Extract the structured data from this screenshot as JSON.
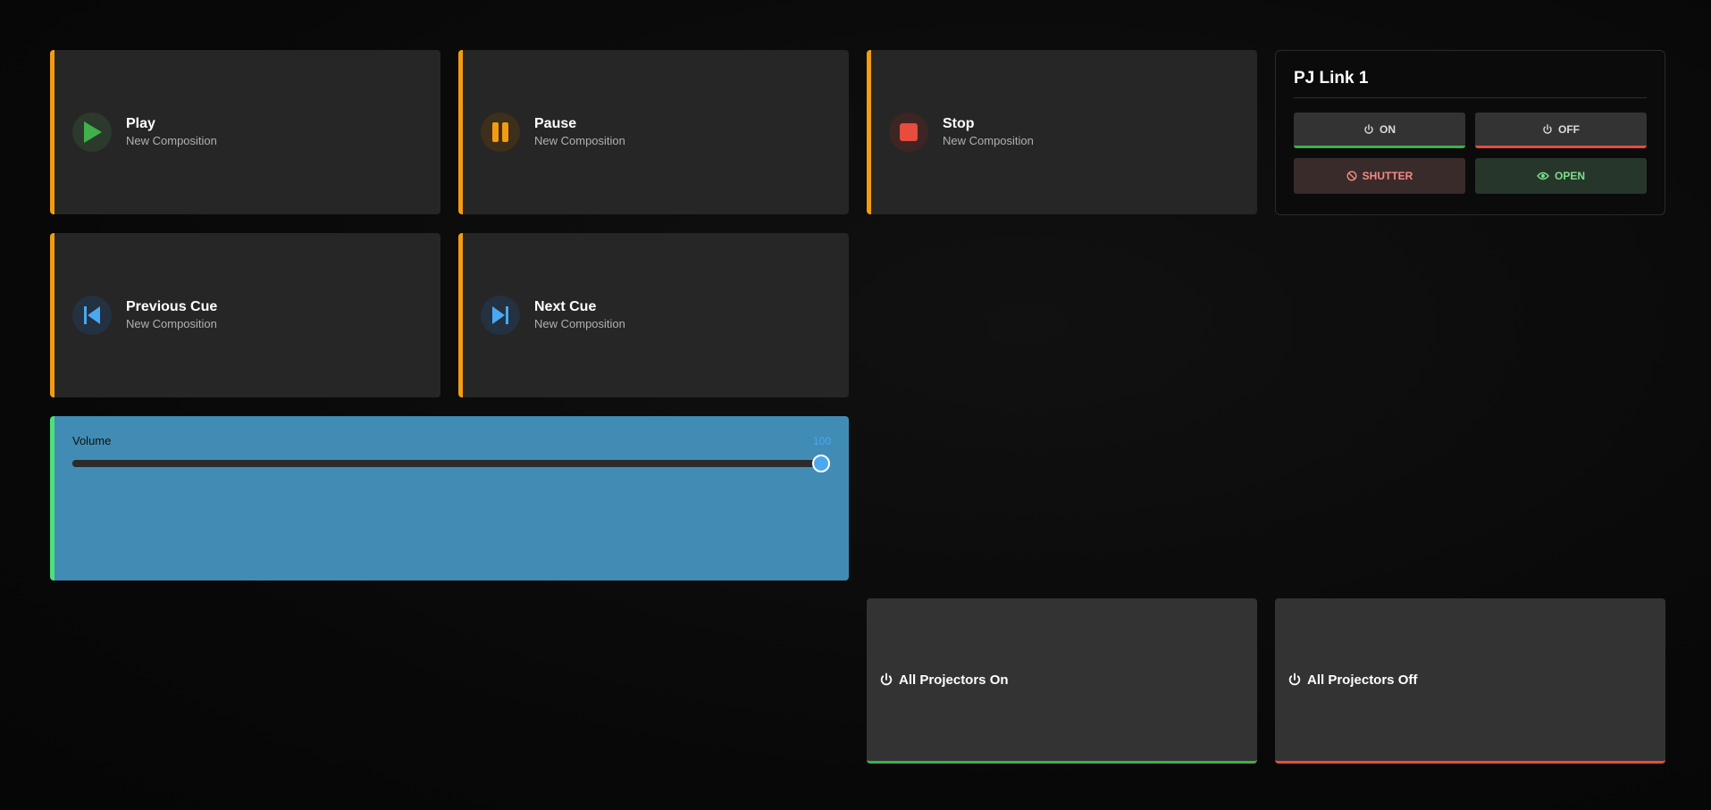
{
  "cues": [
    {
      "title": "Play",
      "subtitle": "New Composition",
      "icon": "play-icon"
    },
    {
      "title": "Pause",
      "subtitle": "New Composition",
      "icon": "pause-icon"
    },
    {
      "title": "Stop",
      "subtitle": "New Composition",
      "icon": "stop-icon"
    },
    {
      "title": "Previous Cue",
      "subtitle": "New Composition",
      "icon": "skip-previous-icon"
    },
    {
      "title": "Next Cue",
      "subtitle": "New Composition",
      "icon": "skip-next-icon"
    }
  ],
  "pjlink": {
    "title": "PJ Link 1",
    "on_label": "ON",
    "off_label": "OFF",
    "shutter_label": "SHUTTER",
    "open_label": "OPEN"
  },
  "volume": {
    "label": "Volume",
    "value": "100",
    "level": 100,
    "max": 100
  },
  "all_projectors": {
    "on_label": "All Projectors On",
    "off_label": "All Projectors Off"
  },
  "colors": {
    "cue_accent": "#f39c12",
    "on_green": "#3fb04a",
    "off_red": "#e74c3c",
    "volume_bg": "#418cb4",
    "volume_accent": "#4ee07a",
    "slider_thumb": "#4aa8f0"
  }
}
